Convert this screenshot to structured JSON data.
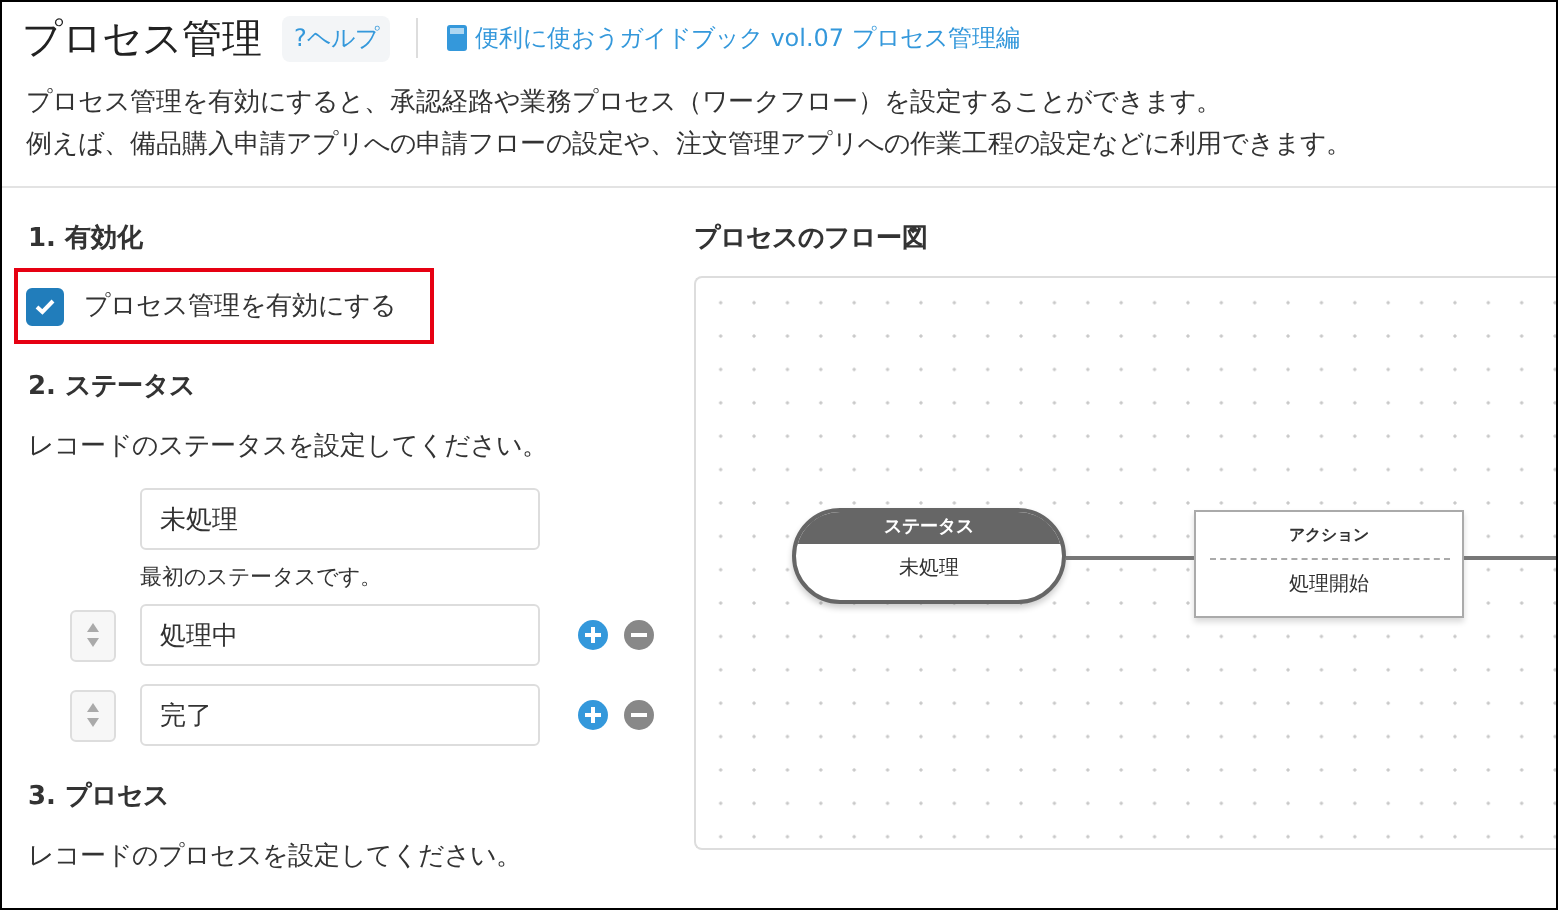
{
  "header": {
    "title": "プロセス管理",
    "help_button": "?ヘルプ",
    "guide_link": "便利に使おうガイドブック vol.07 プロセス管理編"
  },
  "description": [
    "プロセス管理を有効にすると、承認経路や業務プロセス（ワークフロー）を設定することができます。",
    "例えば、備品購入申請アプリへの申請フローの設定や、注文管理アプリへの作業工程の設定などに利用できます。"
  ],
  "enable": {
    "heading": "1. 有効化",
    "checkbox": {
      "label": "プロセス管理を有効にする",
      "checked": true,
      "highlighted": true
    }
  },
  "status": {
    "heading": "2. ステータス",
    "instruction": "レコードのステータスを設定してください。",
    "statuses": [
      {
        "kind": "first",
        "value": "未処理",
        "note": "最初のステータスです。"
      },
      {
        "kind": "sortable",
        "value": "処理中"
      },
      {
        "kind": "sortable",
        "value": "完了"
      }
    ]
  },
  "process": {
    "heading": "3. プロセス",
    "instruction": "レコードのプロセスを設定してください。"
  },
  "flow": {
    "heading": "プロセスのフロー図",
    "nodes": [
      {
        "kind": "status",
        "header": "ステータス",
        "label": "未処理"
      },
      {
        "kind": "action",
        "header": "アクション",
        "label": "処理開始"
      }
    ]
  }
}
